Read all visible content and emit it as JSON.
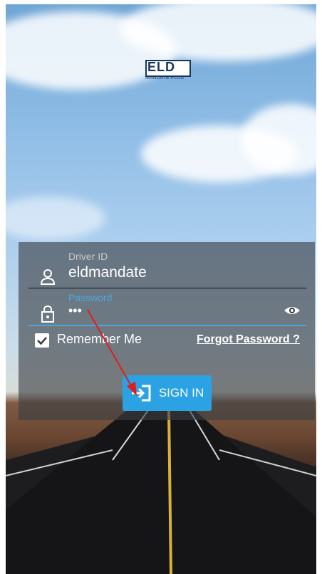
{
  "logo": {
    "text": "ELD",
    "subtext": "MANDATE PLUS"
  },
  "driver_id": {
    "label": "Driver ID",
    "value": "eldmandate"
  },
  "password": {
    "label": "Password",
    "value": "•••"
  },
  "remember_me": {
    "label": "Remember Me",
    "checked": true
  },
  "forgot_password": {
    "label": "Forgot Password ?"
  },
  "sign_in": {
    "label": "SIGN IN"
  },
  "colors": {
    "accent": "#2aa2e4",
    "field_focus": "#4aa8e0"
  },
  "icons": [
    "person-icon",
    "lock-icon",
    "eye-icon",
    "check-icon",
    "sign-in-icon"
  ]
}
